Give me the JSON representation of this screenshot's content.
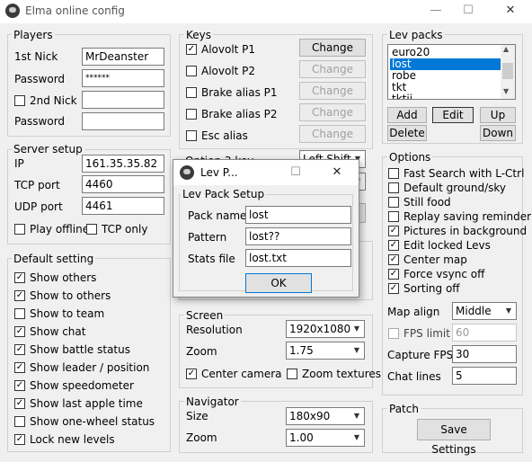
{
  "window": {
    "title": "Elma online config",
    "minimize": "—",
    "maximize": "☐",
    "close": "✕"
  },
  "players": {
    "group_label": "Players",
    "nick1_label": "1st Nick",
    "nick1_value": "MrDeanster",
    "password1_label": "Password",
    "password1_value": "******",
    "nick2_label": "2nd Nick",
    "nick2_checked": false,
    "nick2_value": "",
    "password2_label": "Password",
    "password2_value": ""
  },
  "server": {
    "group_label": "Server setup",
    "ip_label": "IP",
    "ip_value": "161.35.35.82",
    "tcp_label": "TCP port",
    "tcp_value": "4460",
    "udp_label": "UDP port",
    "udp_value": "4461",
    "play_offline_label": "Play offline",
    "play_offline": false,
    "tcp_only_label": "TCP only",
    "tcp_only": false
  },
  "default_setting": {
    "group_label": "Default setting",
    "items": [
      {
        "label": "Show others",
        "checked": true
      },
      {
        "label": "Show to others",
        "checked": true
      },
      {
        "label": "Show to team",
        "checked": false
      },
      {
        "label": "Show chat",
        "checked": true
      },
      {
        "label": "Show battle status",
        "checked": true
      },
      {
        "label": "Show leader / position",
        "checked": true
      },
      {
        "label": "Show speedometer",
        "checked": true
      },
      {
        "label": "Show last apple time",
        "checked": true
      },
      {
        "label": "Show one-wheel status",
        "checked": false
      },
      {
        "label": "Lock new levels",
        "checked": true
      }
    ]
  },
  "keys": {
    "group_label": "Keys",
    "rows": [
      {
        "label": "Alovolt P1",
        "checked": true,
        "button": "Change",
        "enabled": true
      },
      {
        "label": "Alovolt P2",
        "checked": false,
        "button": "Change",
        "enabled": false
      },
      {
        "label": "Brake alias P1",
        "checked": false,
        "button": "Change",
        "enabled": false
      },
      {
        "label": "Brake alias P2",
        "checked": false,
        "button": "Change",
        "enabled": false
      },
      {
        "label": "Esc alias",
        "checked": false,
        "button": "Change",
        "enabled": false
      }
    ],
    "option_partial": "Option 3 key",
    "option_value_partial": "Left Shift"
  },
  "screen": {
    "group_label": "Screen",
    "resolution_label": "Resolution",
    "resolution_value": "1920x1080",
    "zoom_label": "Zoom",
    "zoom_value": "1.75",
    "center_camera_label": "Center camera",
    "center_camera": true,
    "zoom_textures_label": "Zoom textures",
    "zoom_textures": false
  },
  "navigator": {
    "group_label": "Navigator",
    "size_label": "Size",
    "size_value": "180x90",
    "zoom_label": "Zoom",
    "zoom_value": "1.00"
  },
  "levpacks": {
    "group_label": "Lev packs",
    "items": [
      "euro20",
      "lost",
      "robe",
      "tkt",
      "tktii"
    ],
    "selected_index": 1,
    "add": "Add",
    "edit": "Edit",
    "up": "Up",
    "delete": "Delete",
    "down": "Down"
  },
  "options": {
    "group_label": "Options",
    "items": [
      {
        "label": "Fast Search with L-Ctrl",
        "checked": false
      },
      {
        "label": "Default ground/sky",
        "checked": false
      },
      {
        "label": "Still food",
        "checked": false
      },
      {
        "label": "Replay saving reminder",
        "checked": false
      },
      {
        "label": "Pictures in background",
        "checked": true
      },
      {
        "label": "Edit locked Levs",
        "checked": true
      },
      {
        "label": "Center map",
        "checked": true
      },
      {
        "label": "Force vsync off",
        "checked": true
      },
      {
        "label": "Sorting off",
        "checked": true
      }
    ],
    "map_align_label": "Map align",
    "map_align_value": "Middle",
    "fps_limit_label": "FPS limit",
    "fps_limit_checked": false,
    "fps_limit_value": "60",
    "capture_fps_label": "Capture FPS",
    "capture_fps_value": "30",
    "chat_lines_label": "Chat lines",
    "chat_lines_value": "5"
  },
  "patch": {
    "group_label": "Patch",
    "save_button": "Save Settings"
  },
  "dialog": {
    "title": "Lev P...",
    "group_label": "Lev Pack Setup",
    "pack_name_label": "Pack name",
    "pack_name_value": "lost",
    "pattern_label": "Pattern",
    "pattern_value": "lost??",
    "stats_label": "Stats file",
    "stats_value": "lost.txt",
    "ok": "OK",
    "maximize": "☐",
    "close": "✕"
  }
}
